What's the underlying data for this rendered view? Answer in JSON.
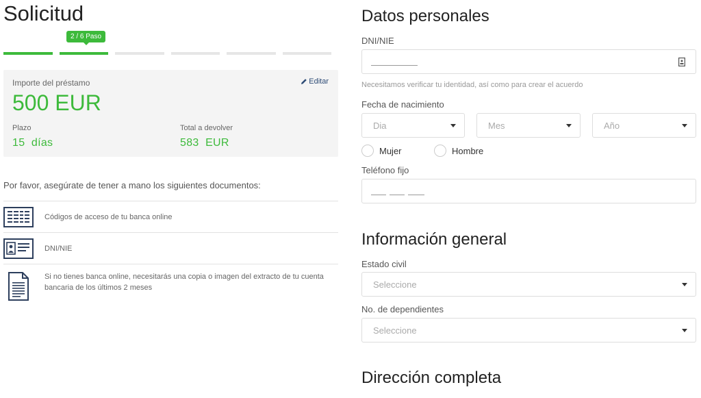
{
  "left": {
    "title": "Solicitud",
    "step_badge": "2 / 6 Paso",
    "steps_total": 6,
    "steps_done": 2,
    "loan": {
      "amount_label": "Importe del préstamo",
      "edit_label": "Editar",
      "amount": "500 EUR",
      "plazo_label": "Plazo",
      "plazo_value": "15  días",
      "total_label": "Total a devolver",
      "total_value": "583  EUR"
    },
    "docs_intro": "Por favor, asegúrate de tener a mano los siguientes documentos:",
    "docs": [
      {
        "icon": "bank-codes-icon",
        "text": "Códigos de acceso de tu banca online"
      },
      {
        "icon": "id-card-icon",
        "text": "DNI/NIE"
      },
      {
        "icon": "document-icon",
        "text": "Si no tienes banca online, necesitarás una copia o imagen del extracto de tu cuenta bancaria de los últimos 2 meses"
      }
    ]
  },
  "right": {
    "personal_title": "Datos personales",
    "dni_label": "DNI/NIE",
    "dni_hint": "Necesitamos verificar tu identidad, así como para crear el acuerdo",
    "birth_label": "Fecha de nacimiento",
    "day_placeholder": "Dia",
    "month_placeholder": "Mes",
    "year_placeholder": "Año",
    "gender_female": "Mujer",
    "gender_male": "Hombre",
    "phone_label": "Teléfono fijo",
    "general_title": "Información general",
    "civil_label": "Estado civil",
    "civil_placeholder": "Seleccione",
    "dependents_label": "No. de dependientes",
    "dependents_placeholder": "Seleccione",
    "address_title": "Dirección completa"
  },
  "colors": {
    "accent_green": "#3dba3b",
    "edit_link": "#2c4a75"
  }
}
